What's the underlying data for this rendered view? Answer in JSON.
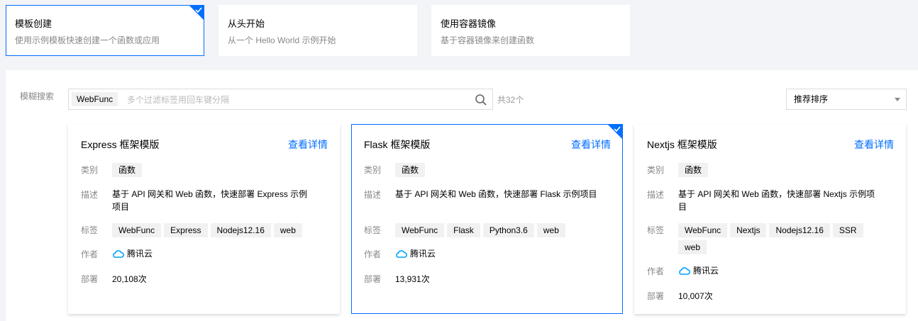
{
  "options": [
    {
      "title": "模板创建",
      "desc": "使用示例模板快速创建一个函数或应用",
      "selected": true
    },
    {
      "title": "从头开始",
      "desc": "从一个 Hello World 示例开始",
      "selected": false
    },
    {
      "title": "使用容器镜像",
      "desc": "基于容器镜像来创建函数",
      "selected": false
    }
  ],
  "search": {
    "label": "模糊搜索",
    "tag": "WebFunc",
    "placeholder": "多个过滤标签用回车键分隔",
    "count": "共32个"
  },
  "sort": {
    "selected": "推荐排序"
  },
  "labels": {
    "category": "类别",
    "desc": "描述",
    "tags": "标签",
    "author": "作者",
    "deploy": "部署"
  },
  "cards": [
    {
      "title": "Express 框架模版",
      "detail": "查看详情",
      "category": "函数",
      "desc": "基于 API 网关和 Web 函数，快速部署 Express 示例项目",
      "tags": [
        "WebFunc",
        "Express",
        "Nodejs12.16",
        "web"
      ],
      "author": "腾讯云",
      "deploy": "20,108次"
    },
    {
      "title": "Flask 框架模版",
      "detail": "查看详情",
      "category": "函数",
      "desc": "基于 API 网关和 Web 函数，快速部署 Flask 示例项目",
      "tags": [
        "WebFunc",
        "Flask",
        "Python3.6",
        "web"
      ],
      "author": "腾讯云",
      "deploy": "13,931次"
    },
    {
      "title": "Nextjs 框架模版",
      "detail": "查看详情",
      "category": "函数",
      "desc": "基于 API 网关和 Web 函数，快速部署 Nextjs 示例项目",
      "tags": [
        "WebFunc",
        "Nextjs",
        "Nodejs12.16",
        "SSR",
        "web"
      ],
      "author": "腾讯云",
      "deploy": "10,007次"
    }
  ],
  "colors": {
    "accent": "#006eff",
    "cloud": "#00a4ff"
  }
}
